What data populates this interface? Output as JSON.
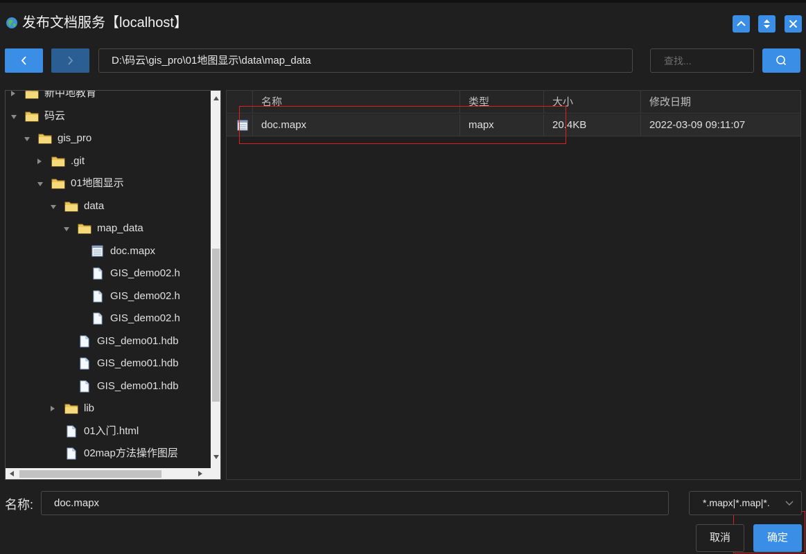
{
  "window": {
    "title": "发布文档服务【localhost】",
    "icon": "globe-icon"
  },
  "toolbar": {
    "path": "D:\\码云\\gis_pro\\01地图显示\\data\\map_data",
    "search_placeholder": "查找..."
  },
  "tree": {
    "items": [
      {
        "label": "新中地教育",
        "type": "folder",
        "state": "collapsed"
      },
      {
        "label": "码云",
        "type": "folder",
        "state": "expanded"
      },
      {
        "label": "gis_pro",
        "type": "folder",
        "state": "expanded"
      },
      {
        "label": ".git",
        "type": "folder",
        "state": "collapsed"
      },
      {
        "label": "01地图显示",
        "type": "folder",
        "state": "expanded"
      },
      {
        "label": "data",
        "type": "folder",
        "state": "expanded"
      },
      {
        "label": "map_data",
        "type": "folder",
        "state": "expanded"
      },
      {
        "label": "doc.mapx",
        "type": "mapx",
        "state": "leaf"
      },
      {
        "label": "GIS_demo02.h",
        "type": "file",
        "state": "leaf"
      },
      {
        "label": "GIS_demo02.h",
        "type": "file",
        "state": "leaf"
      },
      {
        "label": "GIS_demo02.h",
        "type": "file",
        "state": "leaf"
      },
      {
        "label": "GIS_demo01.hdb",
        "type": "file",
        "state": "leaf"
      },
      {
        "label": "GIS_demo01.hdb",
        "type": "file",
        "state": "leaf"
      },
      {
        "label": "GIS_demo01.hdb",
        "type": "file",
        "state": "leaf"
      },
      {
        "label": "lib",
        "type": "folder",
        "state": "collapsed"
      },
      {
        "label": "01入门.html",
        "type": "file",
        "state": "leaf"
      },
      {
        "label": "02map方法操作图层",
        "type": "file",
        "state": "leaf"
      }
    ]
  },
  "file_list": {
    "columns": {
      "name": "名称",
      "type": "类型",
      "size": "大小",
      "modified": "修改日期"
    },
    "rows": [
      {
        "name": "doc.mapx",
        "type": "mapx",
        "size": "20.4KB",
        "modified": "2022-03-09 09:11:07"
      }
    ]
  },
  "footer": {
    "name_label": "名称:",
    "name_value": "doc.mapx",
    "filter_value": "*.mapx|*.map|*.",
    "cancel_label": "取消",
    "ok_label": "确定"
  },
  "colors": {
    "accent": "#3a8ee6",
    "background": "#1f1f1f",
    "highlight_box": "#e02020"
  }
}
